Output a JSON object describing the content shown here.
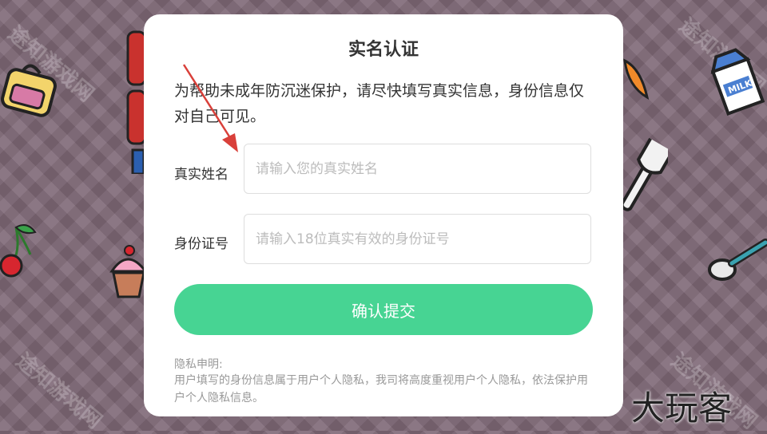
{
  "modal": {
    "title": "实名认证",
    "description": "为帮助未成年防沉迷保护，请尽快填写真实信息，身份信息仅对自己可见。",
    "name_field": {
      "label": "真实姓名",
      "placeholder": "请输入您的真实姓名",
      "value": ""
    },
    "id_field": {
      "label": "身份证号",
      "placeholder": "请输入18位真实有效的身份证号",
      "value": ""
    },
    "submit_label": "确认提交",
    "privacy": {
      "title": "隐私申明:",
      "text": "用户填写的身份信息属于用户个人隐私，我司将高度重视用户个人隐私，依法保护用户个人隐私信息。"
    }
  },
  "watermark": {
    "text": "途知游戏网"
  },
  "brand": {
    "text": "大玩客"
  },
  "colors": {
    "accent": "#47d493",
    "arrow": "#d9403a",
    "background": "#7d6775"
  },
  "icons": [
    "backpack-icon",
    "cherry-icon",
    "cupcake-icon",
    "milk-carton-icon",
    "fork-icon",
    "spoon-icon",
    "carrot-icon",
    "arrow-annotation-icon"
  ]
}
